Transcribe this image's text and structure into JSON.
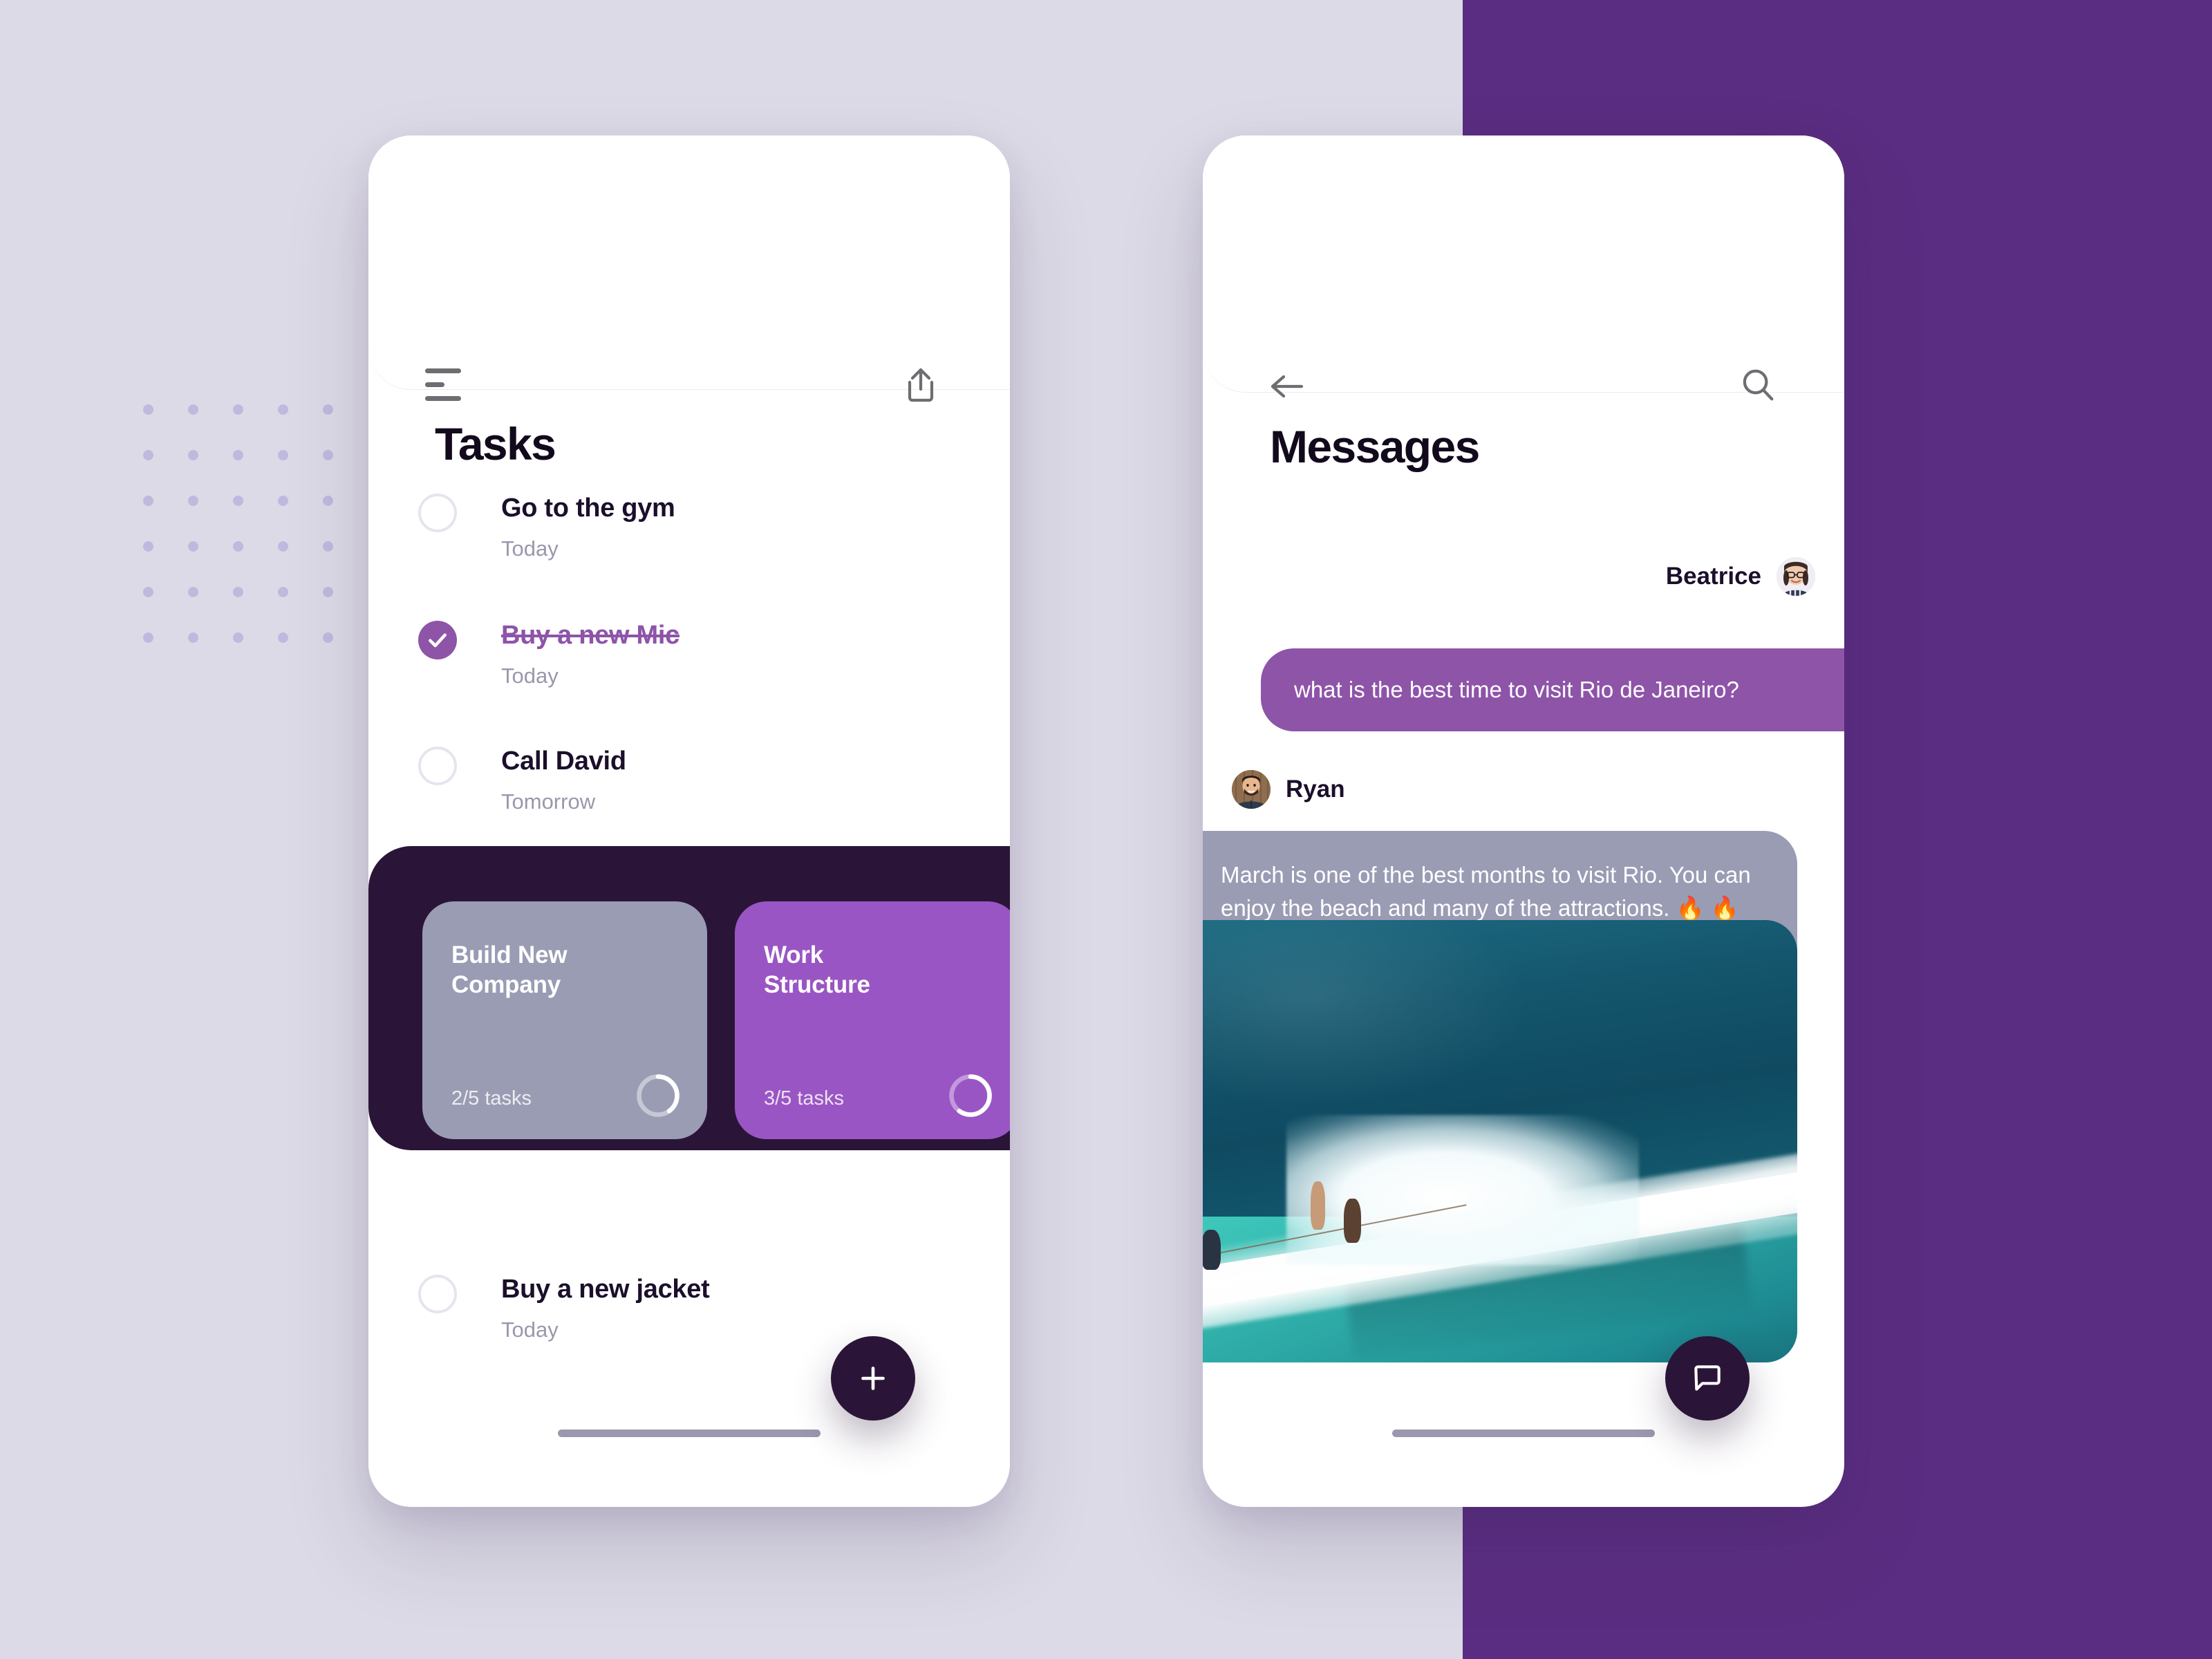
{
  "theme": {
    "background": "#dcdae6",
    "accent_purple": "#8e54a8",
    "deep_purple_block": "#5b2d82",
    "dark_panel": "#2a1538",
    "muted_card": "#9a9cb4",
    "text_dark": "#1b0f2b",
    "text_muted": "#9b97ad"
  },
  "tasks_screen": {
    "title": "Tasks",
    "menu_icon": "hamburger-menu-icon",
    "share_icon": "share-icon",
    "fab_icon": "plus-icon",
    "tasks": [
      {
        "title": "Go to the gym",
        "date": "Today",
        "completed": false
      },
      {
        "title": "Buy a new Mic",
        "date": "Today",
        "completed": true
      },
      {
        "title": "Call David",
        "date": "Tomorrow",
        "completed": false
      },
      {
        "title": "Buy a new jacket",
        "date": "Today",
        "completed": false
      }
    ],
    "projects": [
      {
        "name": "Build New\nCompany",
        "progress_label": "2/5 tasks",
        "done": 2,
        "total": 5,
        "color": "#9a9cb4"
      },
      {
        "name": "Work\nStructure",
        "progress_label": "3/5 tasks",
        "done": 3,
        "total": 5,
        "color": "#9a55c4"
      }
    ]
  },
  "messages_screen": {
    "title": "Messages",
    "back_icon": "arrow-left-icon",
    "search_icon": "search-icon",
    "fab_icon": "chat-bubble-icon",
    "messages": [
      {
        "sender": "Beatrice",
        "direction": "outgoing",
        "text": "what is the best time to visit Rio de Janeiro?",
        "avatar": "beatrice-avatar"
      },
      {
        "sender": "Ryan",
        "direction": "incoming",
        "text": "March is one of the best months to visit Rio. You can enjoy the beach and many of the attractions. 🔥 🔥 🔥",
        "avatar": "ryan-avatar"
      }
    ],
    "attachment": {
      "type": "photo",
      "description": "ocean-pool-wave-photo"
    }
  }
}
